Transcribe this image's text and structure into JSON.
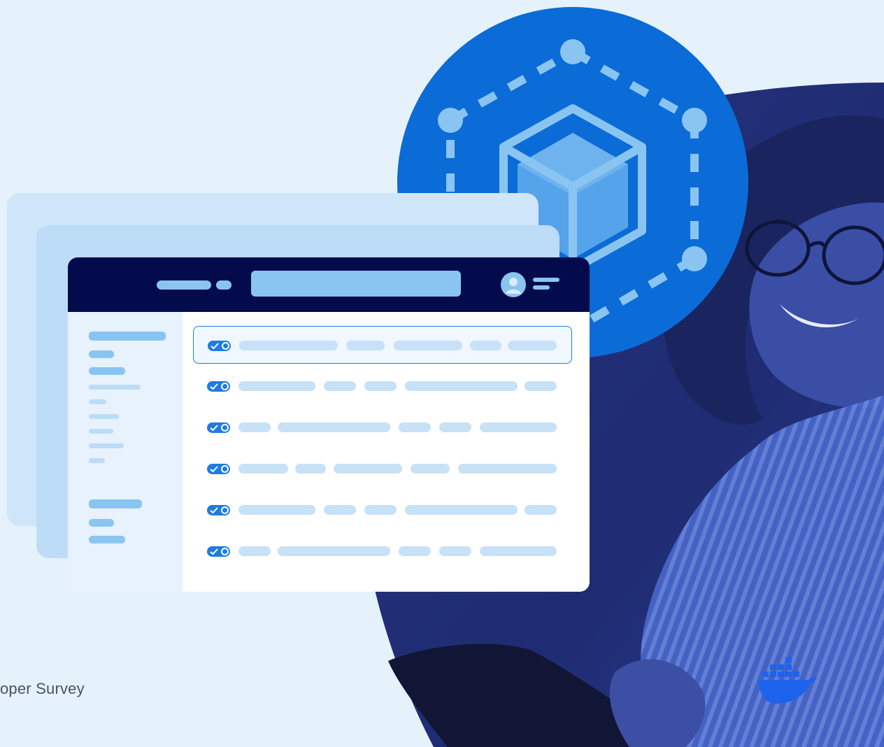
{
  "footer": {
    "survey_text": "oper Survey"
  },
  "branding": {
    "logo_icon": "docker-whale-icon",
    "accent": "#1d63ed"
  },
  "illustration": {
    "network_icon": "container-cube-network-icon",
    "window": {
      "avatar_icon": "user-avatar-icon",
      "menu_icon": "menu-lines-icon",
      "toggles_enabled": [
        true,
        true,
        true,
        true,
        true,
        true
      ],
      "selected_row": 1
    }
  },
  "colors": {
    "background": "#e6f2fb",
    "titlebar": "#040b4c",
    "circle_blue": "#0b6bd7",
    "photo_overlay": "#1f2e7a",
    "placeholder": "#c7e1f7",
    "toggle": "#1d7ce3"
  }
}
